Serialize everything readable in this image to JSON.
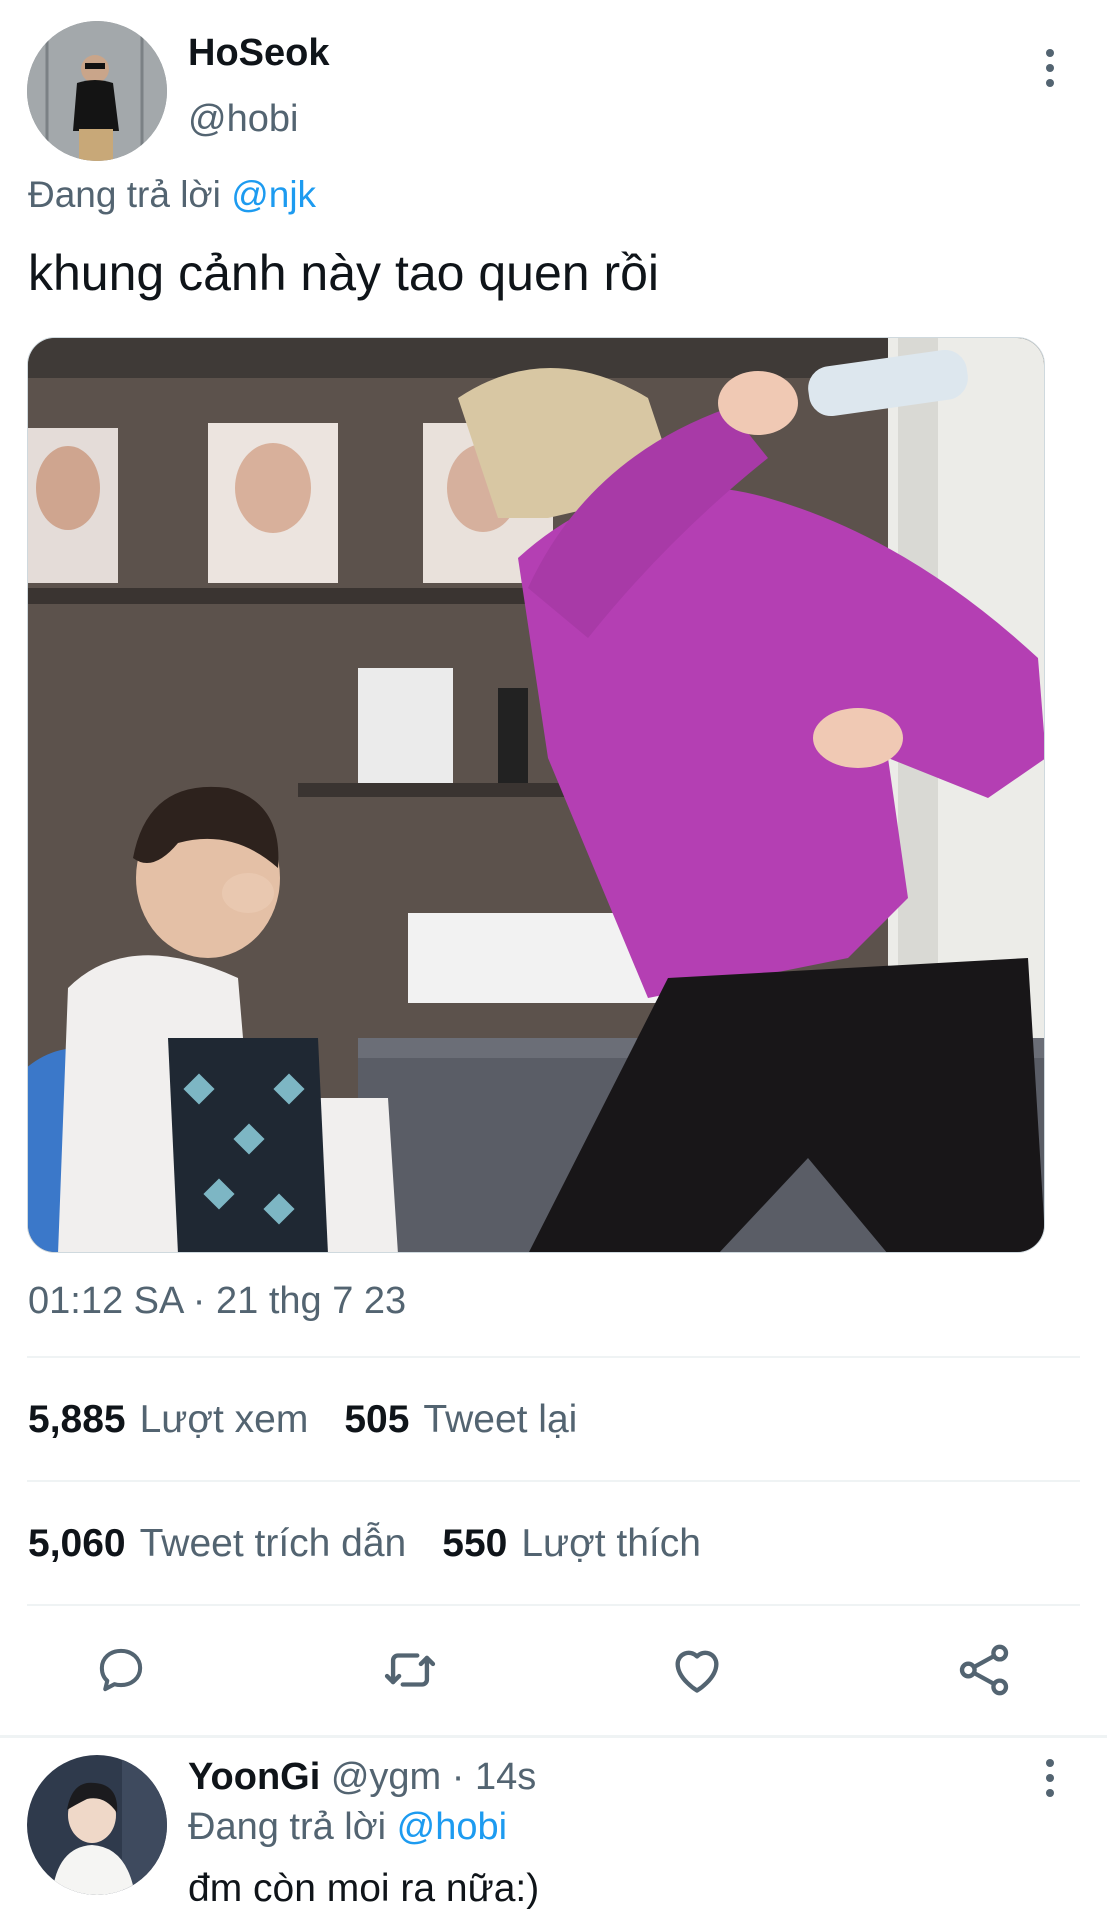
{
  "tweet": {
    "author_name": "HoSeok",
    "author_handle": "@hobi",
    "replying_prefix": "Đang trả lời ",
    "replying_to": "@njk",
    "text": "khung cảnh này tao quen rồi",
    "timestamp": "01:12 SA · 21 thg 7 23",
    "stats": {
      "views_count": "5,885",
      "views_label": "Lượt xem",
      "retweets_count": "505",
      "retweets_label": "Tweet lại",
      "quotes_count": "5,060",
      "quotes_label": "Tweet trích dẫn",
      "likes_count": "550",
      "likes_label": "Lượt thích"
    },
    "icons": {
      "more": "more-vertical-icon",
      "reply": "comment-icon",
      "retweet": "retweet-icon",
      "like": "heart-icon",
      "share": "share-icon"
    }
  },
  "reply": {
    "author_name": "YoonGi",
    "author_handle": "@ygm",
    "separator": " · ",
    "time": "14s",
    "replying_prefix": "Đang trả lời ",
    "replying_to": "@hobi",
    "text": "đm còn moi ra nữa:)"
  },
  "colors": {
    "accent": "#1d9bf0",
    "text_primary": "#0f1419",
    "text_secondary": "#536471"
  }
}
